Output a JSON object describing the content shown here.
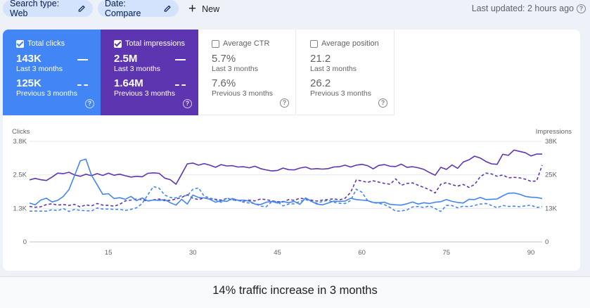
{
  "filters": {
    "search_type": "Search type: Web",
    "date": "Date: Compare",
    "new_label": "New",
    "last_updated": "Last updated: 2 hours ago"
  },
  "metrics": [
    {
      "key": "clicks",
      "label": "Total clicks",
      "checked": true,
      "value": "143K",
      "period": "Last 3 months",
      "compare_value": "125K",
      "compare_period": "Previous 3 months",
      "color": "#4285f4"
    },
    {
      "key": "impressions",
      "label": "Total impressions",
      "checked": true,
      "value": "2.5M",
      "period": "Last 3 months",
      "compare_value": "1.64M",
      "compare_period": "Previous 3 months",
      "color": "#5e35b1"
    },
    {
      "key": "ctr",
      "label": "Average CTR",
      "checked": false,
      "value": "5.7%",
      "period": "Last 3 months",
      "compare_value": "7.6%",
      "compare_period": "Previous 3 months"
    },
    {
      "key": "position",
      "label": "Average position",
      "checked": false,
      "value": "21.2",
      "period": "Last 3 months",
      "compare_value": "26.2",
      "compare_period": "Previous 3 months"
    }
  ],
  "chart_data": {
    "type": "line",
    "ylabel": "Clicks",
    "y2label": "Impressions",
    "ylim": [
      0,
      3800
    ],
    "y2lim": [
      0,
      38000
    ],
    "yticks": [
      "0",
      "1.3K",
      "2.5K",
      "3.8K"
    ],
    "y2ticks": [
      "0",
      "13K",
      "25K",
      "38K"
    ],
    "xlim": [
      1,
      92
    ],
    "xticks": [
      "15",
      "30",
      "45",
      "60",
      "75",
      "90"
    ],
    "grid": true,
    "series": [
      {
        "metric": "impressions",
        "period": "current",
        "style": "solid",
        "color": "#5e35b1",
        "values": [
          23400,
          24000,
          23500,
          23200,
          24500,
          26000,
          25800,
          26300,
          25300,
          24800,
          25600,
          25000,
          25800,
          25100,
          26000,
          25200,
          25600,
          25000,
          24500,
          24800,
          24600,
          25900,
          26100,
          25900,
          24100,
          23500,
          21800,
          25600,
          29500,
          29800,
          29000,
          29600,
          29000,
          28200,
          29200,
          28700,
          28800,
          28300,
          28400,
          28000,
          28600,
          27700,
          27200,
          26800,
          27000,
          27900,
          27300,
          27200,
          27900,
          28300,
          27500,
          27700,
          27500,
          27700,
          28300,
          28400,
          29000,
          28300,
          29000,
          29300,
          28800,
          27600,
          28900,
          29200,
          28600,
          28500,
          29400,
          28200,
          28400,
          28000,
          27400,
          26200,
          25200,
          28200,
          27400,
          29100,
          27800,
          30200,
          31000,
          32400,
          31700,
          30400,
          29500,
          29300,
          33100,
          32700,
          34700,
          34200,
          33700,
          32500,
          33200,
          33200
        ]
      },
      {
        "metric": "impressions",
        "period": "previous",
        "style": "dashed",
        "color": "#5e35b1",
        "values": [
          13400,
          13100,
          13300,
          14100,
          14400,
          13900,
          14100,
          13800,
          14200,
          13200,
          14000,
          13600,
          14500,
          13900,
          13800,
          13500,
          14200,
          15500,
          15800,
          16200,
          16000,
          15400,
          15900,
          16200,
          15600,
          15700,
          16200,
          16800,
          17800,
          16500,
          16000,
          16600,
          16300,
          16100,
          15800,
          16400,
          15900,
          15600,
          15400,
          15800,
          15500,
          16200,
          16000,
          15500,
          15200,
          15100,
          16000,
          15700,
          16500,
          16200,
          15800,
          15400,
          15800,
          16000,
          16300,
          15900,
          16500,
          18700,
          23400,
          23000,
          22500,
          23100,
          22600,
          22100,
          21800,
          23800,
          21400,
          22100,
          22300,
          21400,
          20600,
          19700,
          18500,
          21800,
          22400,
          21600,
          21100,
          21700,
          20600,
          21700,
          24600,
          26000,
          25700,
          24800,
          25300,
          24200,
          24400,
          24200,
          23700,
          22900,
          23000,
          29000
        ]
      },
      {
        "metric": "clicks",
        "period": "current",
        "style": "solid",
        "color": "#4285f4",
        "values": [
          1470,
          1400,
          1580,
          1650,
          1510,
          1570,
          1720,
          1980,
          2510,
          3060,
          3130,
          2520,
          2160,
          1800,
          1820,
          1640,
          1670,
          1610,
          1720,
          1560,
          1660,
          1550,
          1580,
          1570,
          1600,
          1480,
          1390,
          1610,
          1430,
          1770,
          1680,
          1660,
          1610,
          1500,
          1560,
          1530,
          1640,
          1570,
          1580,
          1540,
          1430,
          1410,
          1500,
          1530,
          1470,
          1530,
          1480,
          1530,
          1420,
          1660,
          1540,
          1430,
          1400,
          1470,
          1540,
          1530,
          1540,
          1650,
          1600,
          1580,
          1560,
          1490,
          1480,
          1500,
          1420,
          1400,
          1390,
          1440,
          1510,
          1430,
          1480,
          1450,
          1500,
          1520,
          1600,
          1530,
          1490,
          1470,
          1610,
          1600,
          1680,
          1600,
          1610,
          1620,
          1740,
          1840,
          1850,
          1800,
          1720,
          1690,
          1680,
          1640
        ]
      },
      {
        "metric": "clicks",
        "period": "previous",
        "style": "dashed",
        "color": "#4285f4",
        "values": [
          1160,
          1170,
          1160,
          1160,
          1220,
          1180,
          1260,
          1150,
          1230,
          1190,
          1180,
          1170,
          1280,
          1240,
          1240,
          1230,
          1230,
          1190,
          1230,
          1290,
          1450,
          1780,
          2090,
          2030,
          1770,
          1680,
          1660,
          1750,
          1740,
          1990,
          2040,
          1730,
          1660,
          1590,
          1500,
          1660,
          1590,
          1580,
          1500,
          1470,
          1450,
          1350,
          1330,
          1520,
          1520,
          1360,
          1430,
          1440,
          1530,
          1600,
          1530,
          1460,
          1530,
          1570,
          1500,
          1460,
          1450,
          1560,
          1990,
          1880,
          1560,
          1480,
          1460,
          1410,
          1300,
          1160,
          1170,
          1210,
          1320,
          1340,
          1300,
          1360,
          1260,
          1150,
          1380,
          1370,
          1290,
          1350,
          1330,
          1380,
          1430,
          1450,
          1380,
          1290,
          1380,
          1340,
          1350,
          1330,
          1360,
          1390,
          1300,
          1330
        ]
      }
    ]
  },
  "caption": "14% traffic increase in 3 months"
}
